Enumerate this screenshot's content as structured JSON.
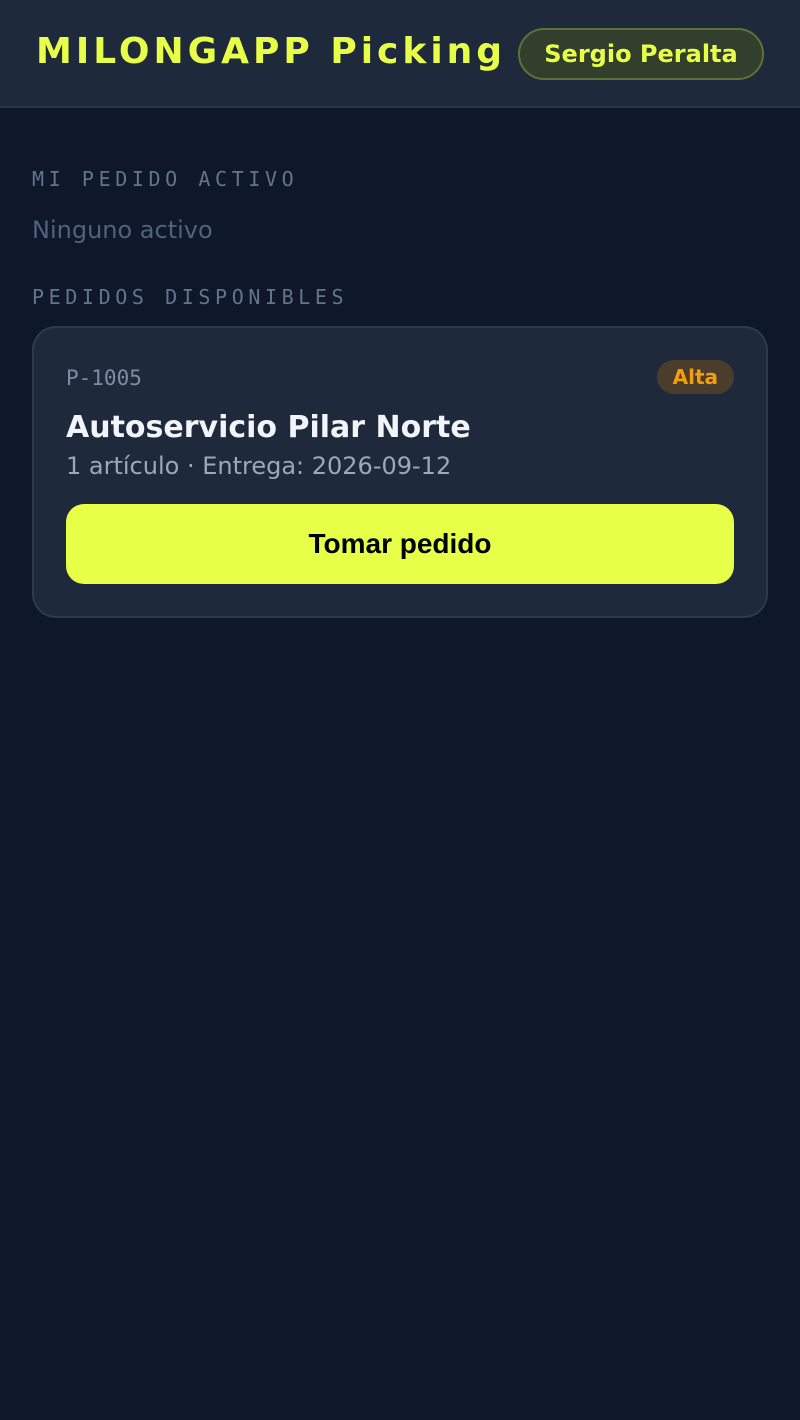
{
  "header": {
    "app_title": "MILONGAPP Picking",
    "user_name": "Sergio Peralta"
  },
  "active_order": {
    "section_label": "MI PEDIDO ACTIVO",
    "empty_text": "Ninguno activo"
  },
  "available_orders": {
    "section_label": "PEDIDOS DISPONIBLES",
    "orders": [
      {
        "id": "P-1005",
        "priority": "Alta",
        "customer": "Autoservicio Pilar Norte",
        "meta": "1 artículo · Entrega: 2026-09-12",
        "action_label": "Tomar pedido"
      }
    ]
  },
  "colors": {
    "background": "#0f172a",
    "surface": "#1e293b",
    "accent": "#e8ff48",
    "priority_high": "#f59e0b",
    "muted_text": "#64748b"
  }
}
